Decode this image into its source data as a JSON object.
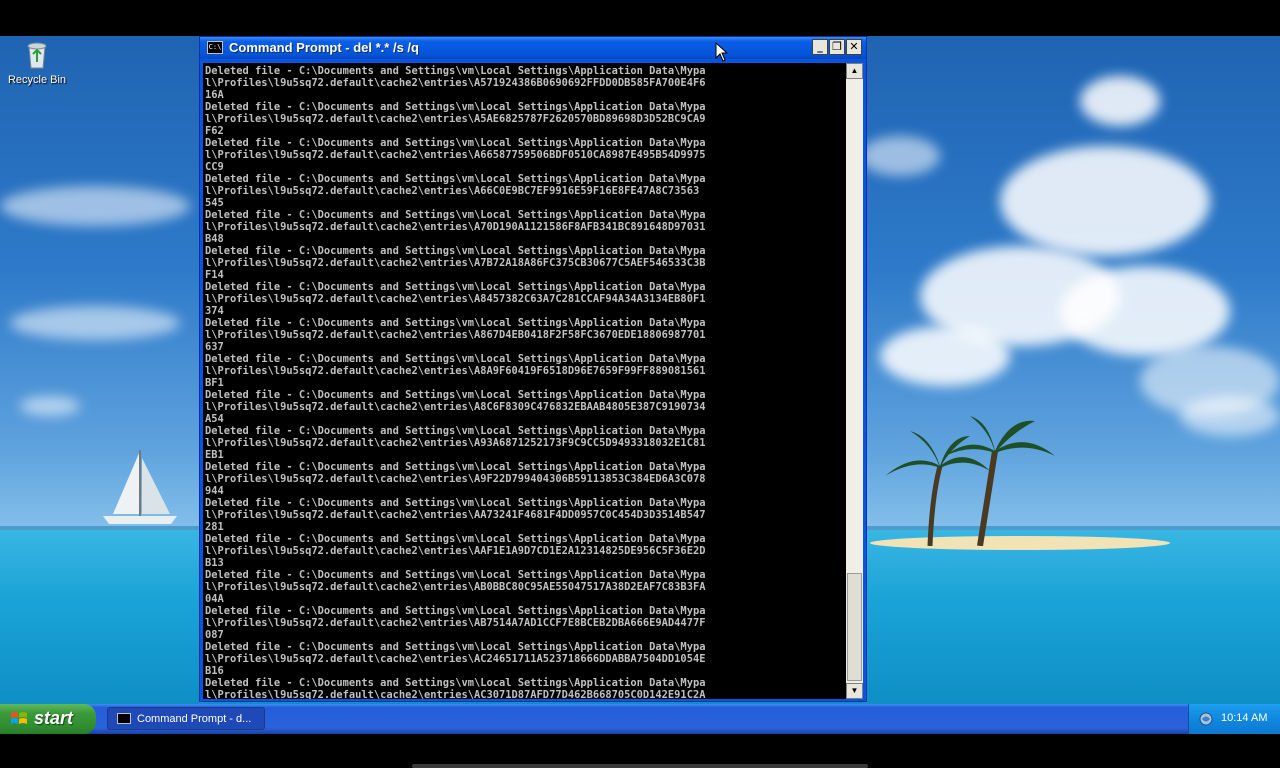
{
  "desktop": {
    "recycle_bin_label": "Recycle Bin"
  },
  "window": {
    "title": "Command Prompt - del *.* /s /q",
    "title_icon_text": "C:\\",
    "buttons": {
      "minimize": "_",
      "maximize": "❐",
      "close": "✕"
    },
    "console_lines": [
      "Deleted file - C:\\Documents and Settings\\vm\\Local Settings\\Application Data\\Mypa",
      "l\\Profiles\\l9u5sq72.default\\cache2\\entries\\A571924386B0690692FFDD0DB585FA700E4F6",
      "16A",
      "Deleted file - C:\\Documents and Settings\\vm\\Local Settings\\Application Data\\Mypa",
      "l\\Profiles\\l9u5sq72.default\\cache2\\entries\\A5AE6825787F2620570BD89698D3D52BC9CA9",
      "F62",
      "Deleted file - C:\\Documents and Settings\\vm\\Local Settings\\Application Data\\Mypa",
      "l\\Profiles\\l9u5sq72.default\\cache2\\entries\\A66587759506BDF0510CA8987E495B54D9975",
      "CC9",
      "Deleted file - C:\\Documents and Settings\\vm\\Local Settings\\Application Data\\Mypa",
      "l\\Profiles\\l9u5sq72.default\\cache2\\entries\\A66C0E9BC7EF9916E59F16E8FE47A8C73563",
      "545",
      "Deleted file - C:\\Documents and Settings\\vm\\Local Settings\\Application Data\\Mypa",
      "l\\Profiles\\l9u5sq72.default\\cache2\\entries\\A70D190A1121586F8AFB341BC891648D97031",
      "B48",
      "Deleted file - C:\\Documents and Settings\\vm\\Local Settings\\Application Data\\Mypa",
      "l\\Profiles\\l9u5sq72.default\\cache2\\entries\\A7B72A18A86FC375CB30677C5AEF546533C3B",
      "F14",
      "Deleted file - C:\\Documents and Settings\\vm\\Local Settings\\Application Data\\Mypa",
      "l\\Profiles\\l9u5sq72.default\\cache2\\entries\\A8457382C63A7C281CCAF94A34A3134EB80F1",
      "374",
      "Deleted file - C:\\Documents and Settings\\vm\\Local Settings\\Application Data\\Mypa",
      "l\\Profiles\\l9u5sq72.default\\cache2\\entries\\A867D4EB0418F2F58FC3670EDE18806987701",
      "637",
      "Deleted file - C:\\Documents and Settings\\vm\\Local Settings\\Application Data\\Mypa",
      "l\\Profiles\\l9u5sq72.default\\cache2\\entries\\A8A9F60419F6518D96E7659F99FF889081561",
      "BF1",
      "Deleted file - C:\\Documents and Settings\\vm\\Local Settings\\Application Data\\Mypa",
      "l\\Profiles\\l9u5sq72.default\\cache2\\entries\\A8C6F8309C476832EBAAB4805E387C9190734",
      "A54",
      "Deleted file - C:\\Documents and Settings\\vm\\Local Settings\\Application Data\\Mypa",
      "l\\Profiles\\l9u5sq72.default\\cache2\\entries\\A93A6871252173F9C9CC5D9493318032E1C81",
      "EB1",
      "Deleted file - C:\\Documents and Settings\\vm\\Local Settings\\Application Data\\Mypa",
      "l\\Profiles\\l9u5sq72.default\\cache2\\entries\\A9F22D799404306B59113853C384ED6A3C078",
      "944",
      "Deleted file - C:\\Documents and Settings\\vm\\Local Settings\\Application Data\\Mypa",
      "l\\Profiles\\l9u5sq72.default\\cache2\\entries\\AA73241F4681F4DD0957C0C454D3D3514B547",
      "281",
      "Deleted file - C:\\Documents and Settings\\vm\\Local Settings\\Application Data\\Mypa",
      "l\\Profiles\\l9u5sq72.default\\cache2\\entries\\AAF1E1A9D7CD1E2A12314825DE956C5F36E2D",
      "B13",
      "Deleted file - C:\\Documents and Settings\\vm\\Local Settings\\Application Data\\Mypa",
      "l\\Profiles\\l9u5sq72.default\\cache2\\entries\\AB0BBC80C95AE55047517A38D2EAF7C83B3FA",
      "04A",
      "Deleted file - C:\\Documents and Settings\\vm\\Local Settings\\Application Data\\Mypa",
      "l\\Profiles\\l9u5sq72.default\\cache2\\entries\\AB7514A7AD1CCF7E8BCEB2DBA666E9AD4477F",
      "087",
      "Deleted file - C:\\Documents and Settings\\vm\\Local Settings\\Application Data\\Mypa",
      "l\\Profiles\\l9u5sq72.default\\cache2\\entries\\AC24651711A523718666DDABBA7504DD1054E",
      "B16",
      "Deleted file - C:\\Documents and Settings\\vm\\Local Settings\\Application Data\\Mypa",
      "l\\Profiles\\l9u5sq72.default\\cache2\\entries\\AC3071D87AFD77D462B668705C0D142E91C2A"
    ],
    "console_text_color": "#c0c0c0",
    "console_bg_color": "#000000"
  },
  "taskbar": {
    "start_label": "start",
    "tasks": [
      {
        "label": "Command Prompt - d..."
      }
    ],
    "clock": "10:14 AM"
  },
  "icons": {
    "recycle_bin": "recycle-bin-icon",
    "cmd": "command-prompt-icon",
    "start": "windows-flag-icon",
    "tray": "network-icon",
    "cursor": "mouse-pointer-icon"
  },
  "colors": {
    "titlebar": "#0554d8",
    "taskbar": "#245edb",
    "start_button": "#3c9a3c",
    "tray": "#1088e0"
  }
}
